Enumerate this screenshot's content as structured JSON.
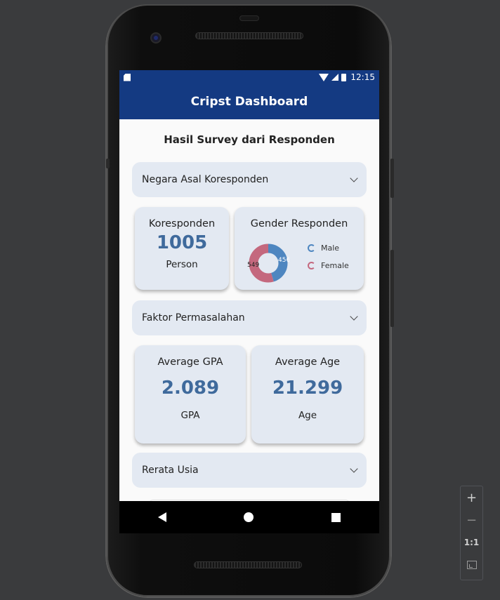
{
  "statusbar": {
    "time": "12:15"
  },
  "appbar": {
    "title": "Cripst Dashboard"
  },
  "main": {
    "heading": "Hasil Survey dari Responden",
    "dropdowns": [
      {
        "label": "Negara Asal Koresponden"
      },
      {
        "label": "Faktor Permasalahan"
      },
      {
        "label": "Rerata Usia"
      }
    ],
    "respondents_card": {
      "title": "Koresponden",
      "value": "1005",
      "unit": "Person"
    },
    "gender_card": {
      "title": "Gender Responden",
      "male": {
        "label": "Male",
        "value": 456,
        "color": "#4e86c0"
      },
      "female": {
        "label": "Female",
        "value": 549,
        "color": "#c4687e"
      }
    },
    "gpa_card": {
      "title": "Average GPA",
      "value": "2.089",
      "unit": "GPA"
    },
    "age_card": {
      "title": "Average Age",
      "value": "21.299",
      "unit": "Age"
    }
  },
  "zoom": {
    "zoom_in": "+",
    "zoom_out": "−",
    "actual_size": "1:1"
  },
  "colors": {
    "appbar": "#143a82",
    "card": "#e3e9f2",
    "accent_value": "#3f6a9c"
  }
}
